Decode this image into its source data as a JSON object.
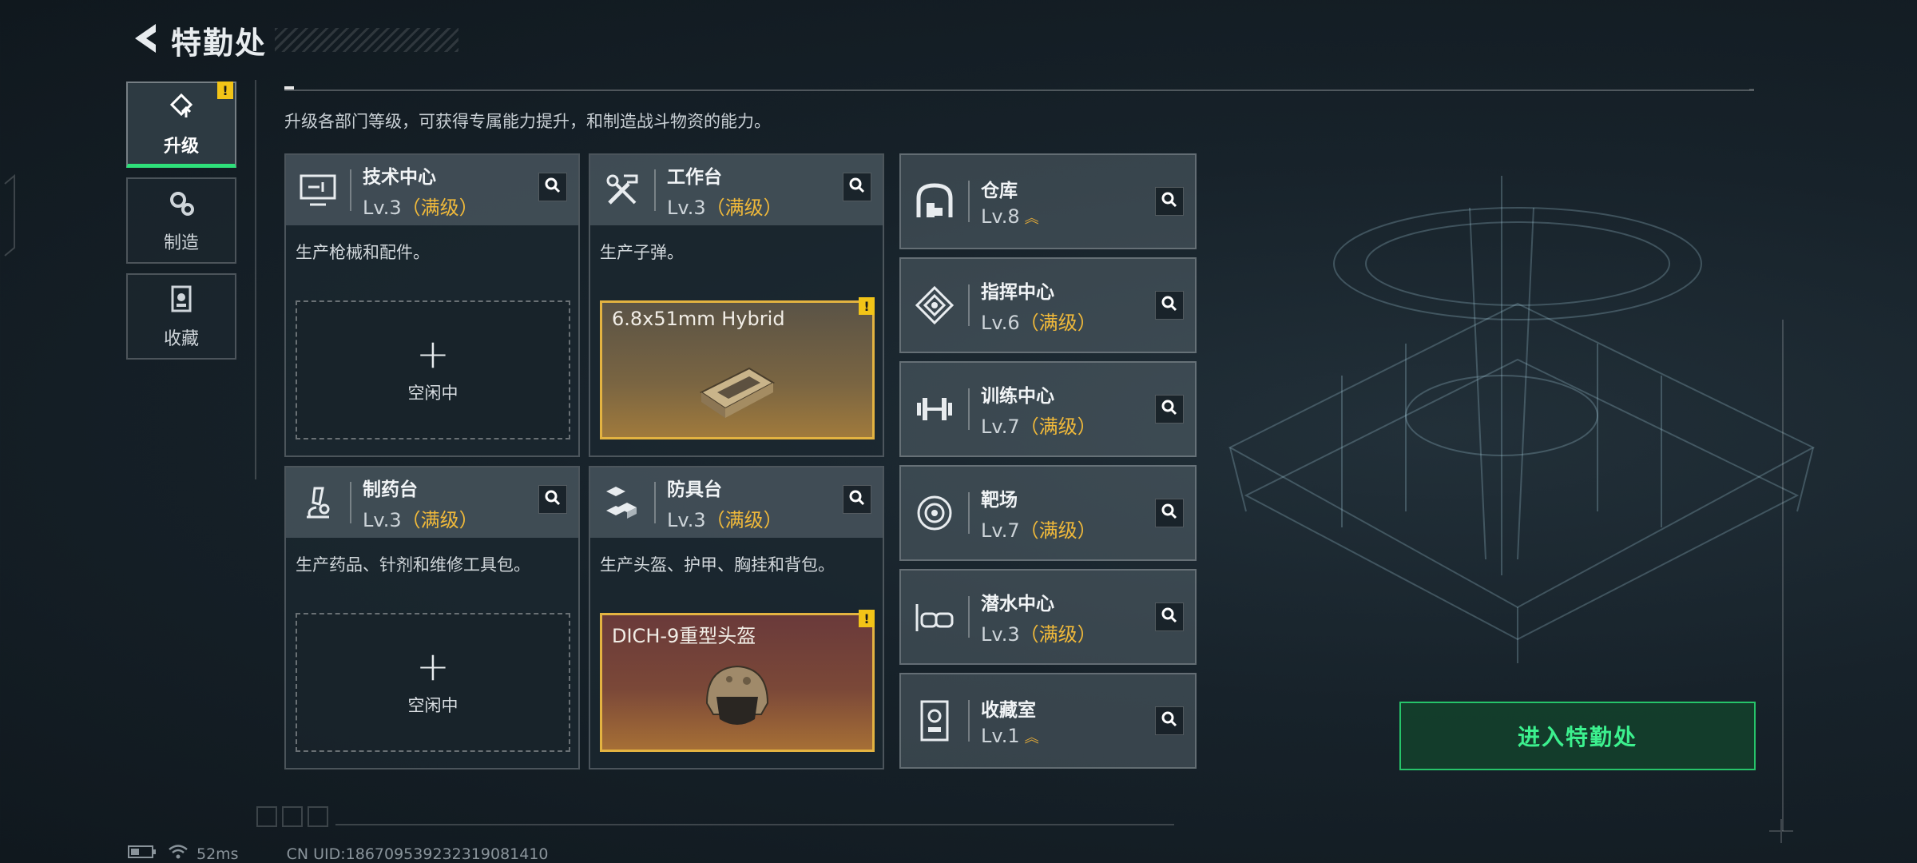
{
  "header": {
    "title": "特勤处"
  },
  "nav": [
    {
      "label": "升级",
      "icon": "upgrade-icon",
      "active": true,
      "alert": "!"
    },
    {
      "label": "制造",
      "icon": "gears-icon",
      "active": false
    },
    {
      "label": "收藏",
      "icon": "collection-icon",
      "active": false
    }
  ],
  "description": "升级各部门等级，可获得专属能力提升，和制造战斗物资的能力。",
  "workshops": [
    {
      "name": "技术中心",
      "level": "Lv.3",
      "max": "（满级）",
      "desc": "生产枪械和配件。",
      "slot": {
        "plus": "+",
        "status": "空闲中"
      }
    },
    {
      "name": "工作台",
      "level": "Lv.3",
      "max": "（满级）",
      "desc": "生产子弹。",
      "slot": {
        "item": "6.8x51mm Hybrid",
        "alert": "!"
      }
    },
    {
      "name": "制药台",
      "level": "Lv.3",
      "max": "（满级）",
      "desc": "生产药品、针剂和维修工具包。",
      "slot": {
        "plus": "+",
        "status": "空闲中"
      }
    },
    {
      "name": "防具台",
      "level": "Lv.3",
      "max": "（满级）",
      "desc": "生产头盔、护甲、胸挂和背包。",
      "slot": {
        "item": "DICH-9重型头盔",
        "alert": "!"
      }
    }
  ],
  "buildings": [
    {
      "name": "仓库",
      "level": "Lv.8",
      "max": "",
      "upgradable": true,
      "icon": "warehouse-icon"
    },
    {
      "name": "指挥中心",
      "level": "Lv.6",
      "max": "（满级）",
      "upgradable": false,
      "icon": "command-icon"
    },
    {
      "name": "训练中心",
      "level": "Lv.7",
      "max": "（满级）",
      "upgradable": false,
      "icon": "dumbbell-icon"
    },
    {
      "name": "靶场",
      "level": "Lv.7",
      "max": "（满级）",
      "upgradable": false,
      "icon": "target-icon"
    },
    {
      "name": "潜水中心",
      "level": "Lv.3",
      "max": "（满级）",
      "upgradable": false,
      "icon": "diving-mask-icon"
    },
    {
      "name": "收藏室",
      "level": "Lv.1",
      "max": "",
      "upgradable": true,
      "icon": "collection-room-icon"
    }
  ],
  "enter_button": "进入特勤处",
  "status": {
    "ping": "52ms",
    "uid": "CN UID:1867095392323190814​10"
  },
  "colors": {
    "accent_green": "#2ee07a",
    "max_level": "#f0b93a",
    "alert": "#f2c417"
  }
}
